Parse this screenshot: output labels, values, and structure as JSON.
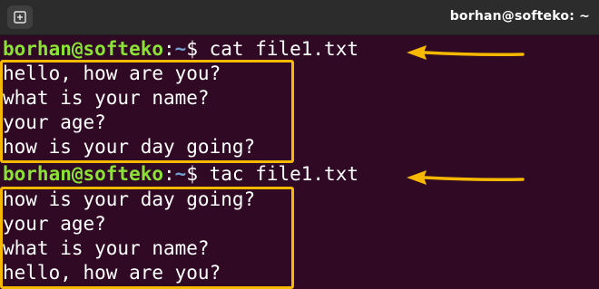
{
  "titlebar": {
    "title": "borhan@softeko: ~",
    "new_tab_icon": "new-tab-icon"
  },
  "prompt": {
    "user_host": "borhan@softeko",
    "separator": ":",
    "path": "~",
    "symbol": "$ "
  },
  "blocks": [
    {
      "command": "cat file1.txt",
      "output": [
        "hello, how are you?",
        "what is your name?",
        "your age?",
        "how is your day going?"
      ]
    },
    {
      "command": "tac file1.txt",
      "output": [
        "how is your day going?",
        "your age?",
        "what is your name?",
        "hello, how are you?"
      ]
    }
  ],
  "annotation_color": "#f7b900",
  "colors": {
    "background": "#300a24",
    "user_host": "#8ae234",
    "path": "#729fcf",
    "text": "#ffffff"
  }
}
